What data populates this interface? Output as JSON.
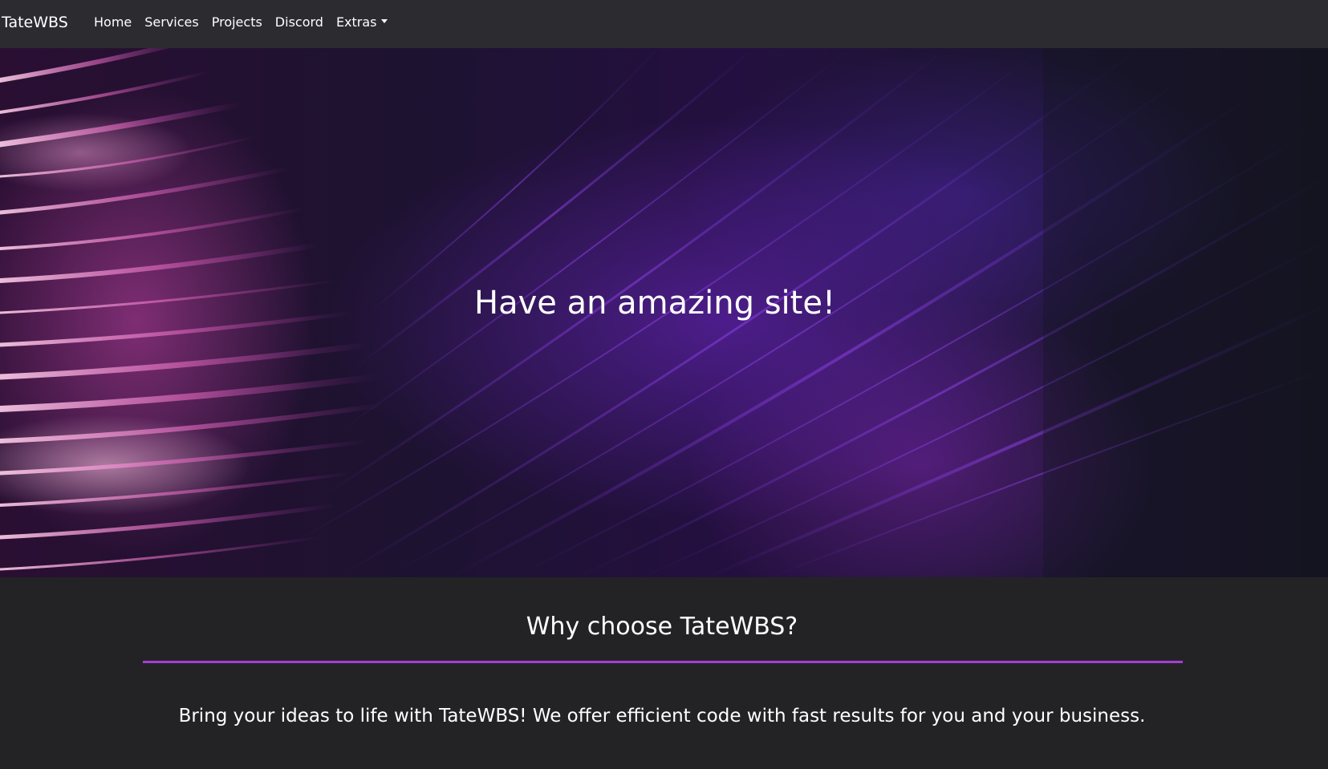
{
  "navbar": {
    "brand": "TateWBS",
    "links": [
      {
        "label": "Home"
      },
      {
        "label": "Services"
      },
      {
        "label": "Projects"
      },
      {
        "label": "Discord"
      },
      {
        "label": "Extras"
      }
    ]
  },
  "hero": {
    "title": "Have an amazing site!"
  },
  "why": {
    "title": "Why choose TateWBS?",
    "text": "Bring your ideas to life with TateWBS! We offer efficient code with fast results for you and your business."
  },
  "colors": {
    "navbar_bg": "#2b2b30",
    "page_bg": "#232325",
    "accent": "#a63ed1"
  }
}
